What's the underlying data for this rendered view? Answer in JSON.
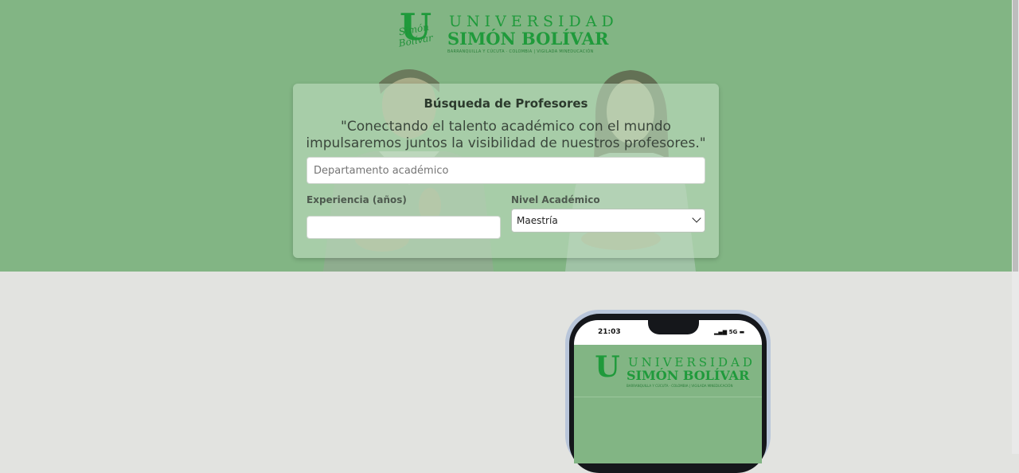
{
  "header": {
    "logo_line1": "UNIVERSIDAD",
    "logo_line2": "SIMÓN BOLÍVAR",
    "logo_tagline": "BARRANQUILLA Y CÚCUTA · COLOMBIA  |  VIGILADA MINEDUCACIÓN",
    "logo_script": "Simón Bolívar"
  },
  "search_card": {
    "title": "Búsqueda de Profesores",
    "quote": "\"Conectando el talento académico con el mundo impulsaremos juntos la visibilidad de nuestros profesores.\"",
    "department_placeholder": "Departamento académico",
    "department_value": "",
    "experience_label": "Experiencia (años)",
    "experience_value": "",
    "level_label": "Nivel Académico",
    "level_selected": "Maestría"
  },
  "phone_preview": {
    "time": "21:03",
    "status": "5G"
  },
  "colors": {
    "hero_green": "#82b584",
    "brand_green": "#1f9a3b",
    "page_bg": "#e2e3e0"
  }
}
